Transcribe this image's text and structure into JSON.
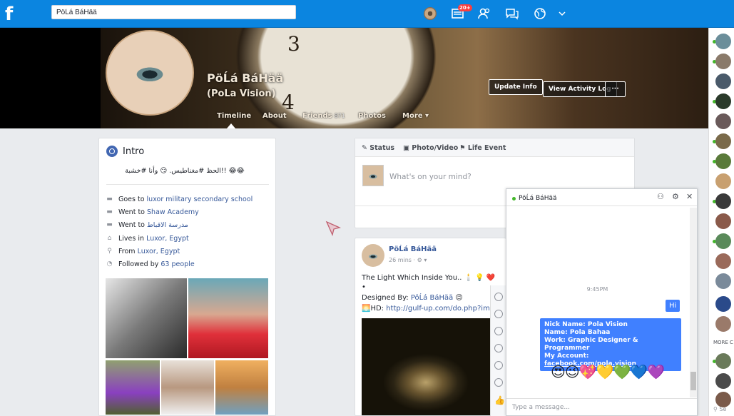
{
  "topbar": {
    "search_value": "PöĹá BáHää",
    "notif_badge": "20+",
    "icons": [
      "profile-avatar",
      "news-icon",
      "friends-icon",
      "messages-icon",
      "globe-icon",
      "chevron-down-icon"
    ]
  },
  "profile": {
    "name": "PöĹá BáHää",
    "subtitle": "(PoLa Vision)",
    "update_info": "Update Info",
    "activity_log": "View Activity Log",
    "more_btn": "···"
  },
  "tabs": [
    {
      "label": "Timeline"
    },
    {
      "label": "About"
    },
    {
      "label": "Friends",
      "count": "871"
    },
    {
      "label": "Photos"
    },
    {
      "label": "More ▾"
    }
  ],
  "intro": {
    "title": "Intro",
    "bio": "الحظ #مغناطيس. 😏 وأنا #خشبة!! 😂😂",
    "items": [
      {
        "prefix": "Goes to ",
        "link": "luxor military secondary school",
        "icon": "school"
      },
      {
        "prefix": "Went to ",
        "link": "Shaw Academy",
        "icon": "school"
      },
      {
        "prefix": "Went to ",
        "link": "مدرسة الاقباط",
        "icon": "school"
      },
      {
        "prefix": "Lives in ",
        "link": "Luxor, Egypt",
        "icon": "home"
      },
      {
        "prefix": "From ",
        "link": "Luxor, Egypt",
        "icon": "pin"
      },
      {
        "prefix": "Followed by ",
        "link": "63 people",
        "icon": "rss"
      }
    ]
  },
  "composer": {
    "tab_status": "Status",
    "tab_photo": "Photo/Video",
    "tab_life": "Life Event",
    "placeholder": "What's on your mind?"
  },
  "post": {
    "author": "PöĹá BáHää",
    "time": "26 mins · ⚙ ▾",
    "line1": "The Light Which Inside You.. 🕯️ 💡 ❤️",
    "line2": "•",
    "line3_prefix": "Designed By: ",
    "line3_link": "PöĹá BáHää",
    "line3_suffix": " 😉",
    "line4_prefix": "🌅HD: ",
    "line4_link": "http://gulf-up.com/do.php?img"
  },
  "chat": {
    "name": "PöĹá BáHää",
    "time": "9:45PM",
    "hi": "Hi",
    "info_lines": [
      "Nick Name: Pola Vision",
      "Name: Pola Bahaa",
      "Work: Graphic Designer & Programmer"
    ],
    "account_prefix": "My Account: ",
    "account_link": "facebook.com/pola.vision",
    "emojis": "😍😉💖💛💚💙💜",
    "input_placeholder": "Type a message..."
  },
  "sidebar": {
    "more": "MORE C",
    "search": "Se"
  },
  "colors": {
    "brand": "#0b85e0",
    "link": "#365899",
    "bubble": "#4080ff",
    "online": "#42b72a"
  }
}
